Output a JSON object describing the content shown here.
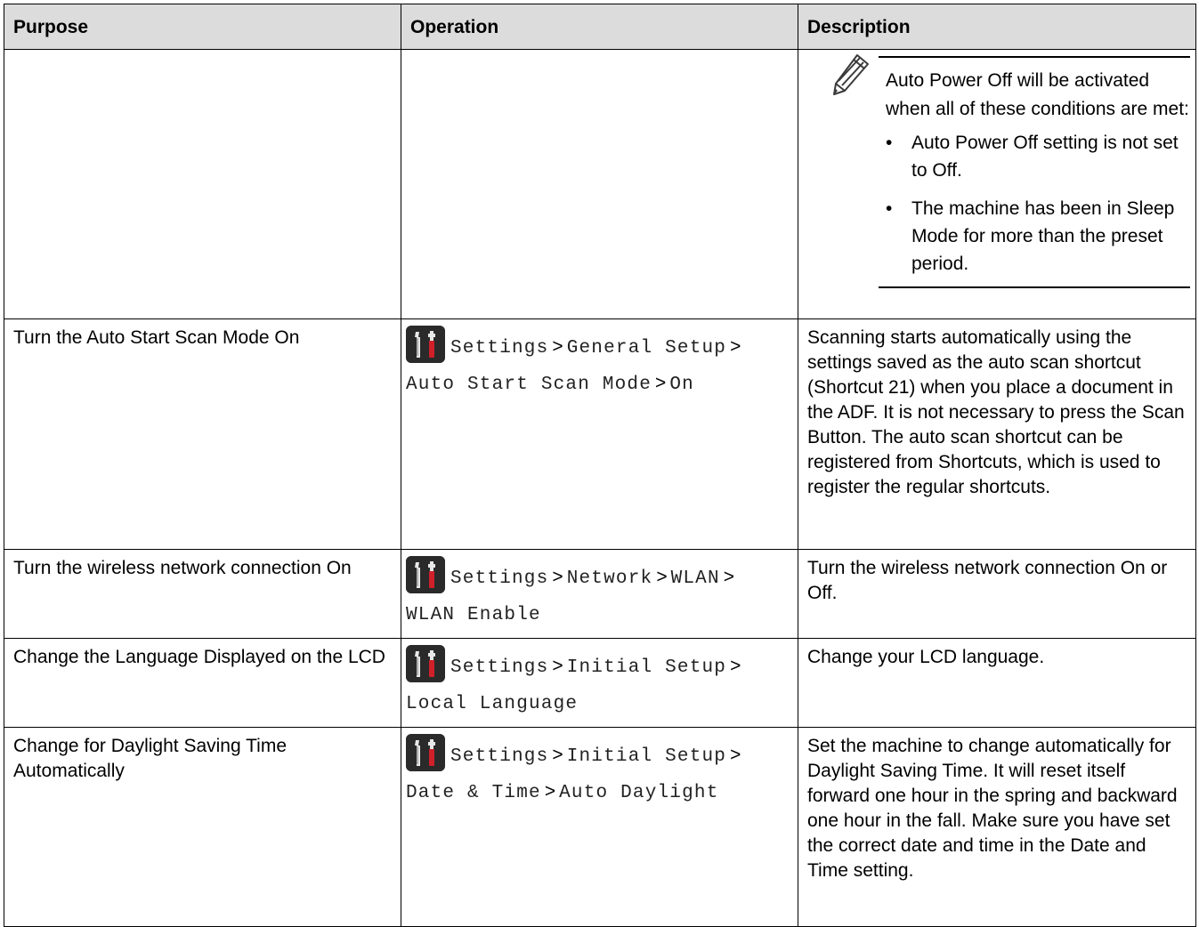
{
  "headers": {
    "purpose": "Purpose",
    "operation": "Operation",
    "description": "Description"
  },
  "note": {
    "intro": "Auto Power Off will be activated when all of these conditions are met:",
    "conditions": [
      "Auto Power Off setting is not set to Off.",
      "The machine has been in Sleep Mode for more than the preset period."
    ]
  },
  "rows": [
    {
      "purpose": "Turn the Auto Start Scan Mode On",
      "path": [
        "Settings",
        "General Setup",
        "Auto Start Scan Mode",
        "On"
      ],
      "description": "Scanning starts automatically using the settings saved as the auto scan shortcut (Shortcut 21) when you place a document in the ADF. It is not necessary to press the Scan Button. The auto scan shortcut can be registered from Shortcuts, which is used to register the regular shortcuts."
    },
    {
      "purpose": "Turn the wireless network connection On",
      "path": [
        "Settings",
        "Network",
        "WLAN",
        "WLAN Enable"
      ],
      "description": "Turn the wireless network connection On or Off."
    },
    {
      "purpose": "Change the Language Displayed on the LCD",
      "path": [
        "Settings",
        "Initial Setup",
        "Local Language"
      ],
      "description": "Change your LCD language."
    },
    {
      "purpose": "Change for Daylight Saving Time Automatically",
      "path": [
        "Settings",
        "Initial Setup",
        "Date & Time",
        "Auto Daylight"
      ],
      "description": "Set the machine to change automatically for Daylight Saving Time. It will reset itself forward one hour in the spring and backward one hour in the fall. Make sure you have set the correct date and time in the Date and Time setting."
    }
  ],
  "separator": ">",
  "icons": {
    "settings": "settings-tools-icon",
    "note": "pencil-note-icon"
  },
  "colors": {
    "header_bg": "#dcdcdc",
    "icon_bg": "#2a2a2a",
    "icon_red": "#d0202a"
  }
}
